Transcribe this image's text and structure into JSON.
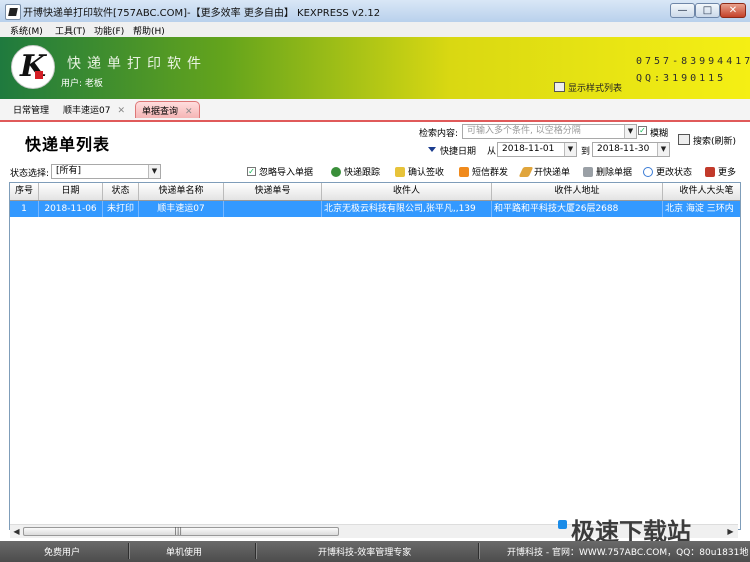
{
  "window": {
    "title": "开博快递单打印软件[757ABC.COM]-【更多效率 更多自由】  KEXPRESS v2.12"
  },
  "menu": [
    "系统(M)",
    "工具(T)",
    "功能(F)",
    "帮助(H)"
  ],
  "banner": {
    "app_name": "快递单打印软件",
    "user": "用户: 老板",
    "phone": "0757-83994417",
    "qq": "QQ:3190115",
    "style_link": "显示样式列表",
    "colors": {
      "left": "#1f7a3e",
      "right": "#f5ef14"
    }
  },
  "tabs": [
    {
      "label": "日常管理",
      "closable": false,
      "active": false
    },
    {
      "label": "顺丰速运07",
      "closable": true,
      "active": false
    },
    {
      "label": "单据查询",
      "closable": true,
      "active": true
    }
  ],
  "page": {
    "title": "快递单列表"
  },
  "search": {
    "label": "检索内容:",
    "placeholder": "可输入多个条件, 以空格分隔",
    "fuzzy_label": "模糊",
    "fuzzy_checked": true,
    "search_button": "搜索(刷新)",
    "date_label": "快捷日期",
    "from_label": "从",
    "from_date": "2018-11-01",
    "to_label": "到",
    "to_date": "2018-11-30"
  },
  "status_filter": {
    "label": "状态选择:",
    "value": "[所有]"
  },
  "toolbar": {
    "ignore_import_label": "忽略导入单据",
    "ignore_import_checked": true,
    "track": "快递跟踪",
    "confirm_receipt": "确认签收",
    "sms": "短信群发",
    "new_bill": "开快递单",
    "delete": "删除单据",
    "change_status": "更改状态",
    "more": "更多"
  },
  "table": {
    "columns": [
      "序号",
      "日期",
      "状态",
      "快递单名称",
      "快递单号",
      "收件人",
      "收件人地址",
      "收件人大头笔"
    ],
    "rows": [
      [
        "1",
        "2018-11-06",
        "未打印",
        "顺丰速运07",
        "",
        "北京无极云科技有限公司,张平凡,,139",
        "和平路和平科技大厦26层2688",
        "北京 海淀 三环内"
      ]
    ],
    "selected_row_color": "#3399ff"
  },
  "statusbar": {
    "user_type": "免费用户",
    "mode": "单机使用",
    "slogan": "开博科技-效率管理专家",
    "company": "开博科技 - 官网：WWW.757ABC.COM，QQ：80u1831地"
  },
  "watermark": "极速下载站"
}
